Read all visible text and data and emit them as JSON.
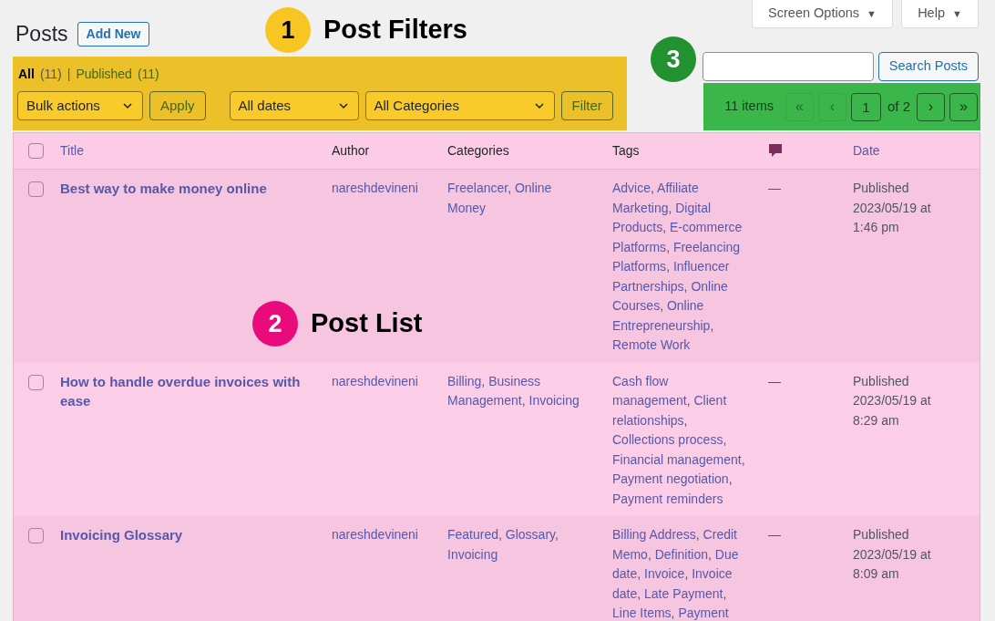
{
  "header_buttons": [
    {
      "label": "Screen Options",
      "caret": "▼"
    },
    {
      "label": "Help",
      "caret": "▼"
    }
  ],
  "page_title": "Posts",
  "add_new": "Add New",
  "views": {
    "separator": "|",
    "items": [
      {
        "label": "All",
        "count": "(11)",
        "selected": true
      },
      {
        "label": "Published",
        "count": "(11)",
        "selected": false
      }
    ]
  },
  "filters": {
    "bulk": "Bulk actions",
    "apply": "Apply",
    "dates": "All dates",
    "categories": "All Categories",
    "filter": "Filter"
  },
  "search": {
    "button": "Search Posts"
  },
  "pagination": {
    "count": "11 items",
    "before": [
      {
        "label": "«",
        "disabled": true
      },
      {
        "label": "‹",
        "disabled": true
      }
    ],
    "current": "1",
    "total": "of 2",
    "after": [
      {
        "label": "›",
        "disabled": false
      },
      {
        "label": "»",
        "disabled": false
      }
    ]
  },
  "table": {
    "select_all": {
      "checked": false
    },
    "separator": ",",
    "columns": [
      {
        "kind": "text",
        "label": "Title",
        "sortable": true
      },
      {
        "kind": "text",
        "label": "Author",
        "sortable": false
      },
      {
        "kind": "text",
        "label": "Categories",
        "sortable": false
      },
      {
        "kind": "text",
        "label": "Tags",
        "sortable": false
      },
      {
        "kind": "comments"
      },
      {
        "kind": "text",
        "label": "Date",
        "sortable": true
      }
    ],
    "rows": [
      {
        "checked": false,
        "title": "Best way to make money online",
        "author": "nareshdevineni",
        "categories": [
          "Freelancer",
          "Online Money"
        ],
        "tags": [
          "Advice",
          "Affiliate Marketing",
          "Digital Products",
          "E-commerce Platforms",
          "Freelancing Platforms",
          "Influencer Partnerships",
          "Online Courses",
          "Online Entrepreneurship",
          "Remote Work"
        ],
        "comments": "—",
        "status": "Published",
        "date": "2023/05/19 at 1:46 pm"
      },
      {
        "checked": false,
        "title": "How to handle overdue invoices with ease",
        "author": "nareshdevineni",
        "categories": [
          "Billing",
          "Business Management",
          "Invoicing"
        ],
        "tags": [
          "Cash flow management",
          "Client relationships",
          "Collections process",
          "Financial management",
          "Payment negotiation",
          "Payment reminders"
        ],
        "comments": "—",
        "status": "Published",
        "date": "2023/05/19 at 8:29 am"
      },
      {
        "checked": false,
        "title": "Invoicing Glossary",
        "author": "nareshdevineni",
        "categories": [
          "Featured",
          "Glossary",
          "Invoicing"
        ],
        "tags": [
          "Billing Address",
          "Credit Memo",
          "Definition",
          "Due date",
          "Invoice",
          "Invoice date",
          "Late Payment",
          "Line Items",
          "Payment"
        ],
        "comments": "—",
        "status": "Published",
        "date": "2023/05/19 at 8:09 am"
      }
    ]
  },
  "callouts": [
    {
      "number": "1",
      "label": "Post Filters",
      "color": "#f7c623"
    },
    {
      "number": "2",
      "label": "Post List",
      "color": "#e90a7c"
    },
    {
      "number": "3",
      "color": "#21922f"
    }
  ]
}
